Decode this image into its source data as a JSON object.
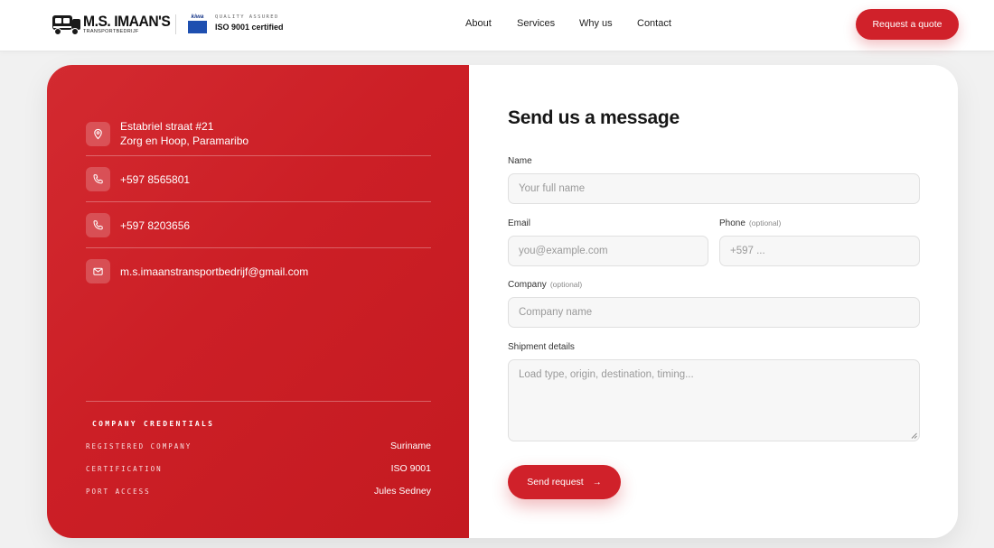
{
  "header": {
    "logo_name": "M.S. IMAAN'S",
    "logo_sub": "TRANSPORTBEDRIJF",
    "kiwa_label": "kiwa",
    "quality_small": "QUALITY ASSURED",
    "quality_big": "ISO 9001 certified",
    "nav": [
      {
        "label": "About"
      },
      {
        "label": "Services"
      },
      {
        "label": "Why us"
      },
      {
        "label": "Contact"
      }
    ],
    "cta_label": "Request a quote"
  },
  "contact": {
    "address_line1": "Estabriel straat #21",
    "address_line2": "Zorg en Hoop, Paramaribo",
    "phone1": "+597 8565801",
    "phone2": "+597 8203656",
    "email": "m.s.imaanstransportbedrijf@gmail.com"
  },
  "credentials": {
    "title": "COMPANY CREDENTIALS",
    "rows": [
      {
        "key": "REGISTERED COMPANY",
        "value": "Suriname"
      },
      {
        "key": "CERTIFICATION",
        "value": "ISO 9001"
      },
      {
        "key": "PORT ACCESS",
        "value": "Jules Sedney"
      }
    ]
  },
  "form": {
    "title": "Send us a message",
    "name_label": "Name",
    "name_placeholder": "Your full name",
    "email_label": "Email",
    "email_placeholder": "you@example.com",
    "phone_label": "Phone",
    "phone_optional": "(optional)",
    "phone_placeholder": "+597 ...",
    "company_label": "Company",
    "company_optional": "(optional)",
    "company_placeholder": "Company name",
    "shipment_label": "Shipment details",
    "shipment_placeholder": "Load type, origin, destination, timing...",
    "submit_label": "Send request",
    "submit_icon": "arrow-right-icon"
  },
  "colors": {
    "brand_red": "#d0212a",
    "panel_red": "#cc1f26"
  }
}
